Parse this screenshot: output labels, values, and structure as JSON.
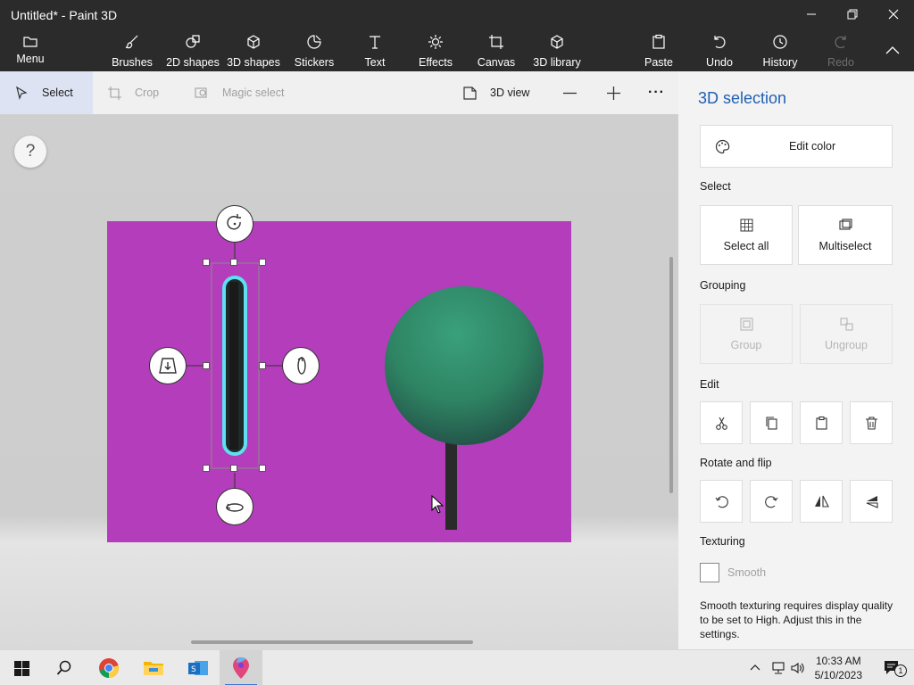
{
  "window": {
    "title": "Untitled* - Paint 3D"
  },
  "ribbon": {
    "menu": "Menu",
    "brushes": "Brushes",
    "shapes2d": "2D shapes",
    "shapes3d": "3D shapes",
    "stickers": "Stickers",
    "text": "Text",
    "effects": "Effects",
    "canvas": "Canvas",
    "library3d": "3D library",
    "paste": "Paste",
    "undo": "Undo",
    "history": "History",
    "redo": "Redo"
  },
  "subbar": {
    "select": "Select",
    "crop": "Crop",
    "magic_select": "Magic select",
    "view3d": "3D view",
    "more": "···"
  },
  "workspace": {
    "help": "?"
  },
  "panel": {
    "title": "3D selection",
    "edit_color": "Edit color",
    "select_label": "Select",
    "select_all": "Select all",
    "multiselect": "Multiselect",
    "grouping_label": "Grouping",
    "group": "Group",
    "ungroup": "Ungroup",
    "edit_label": "Edit",
    "rotate_label": "Rotate and flip",
    "texturing_label": "Texturing",
    "smooth": "Smooth",
    "smooth_note": "Smooth texturing requires display quality to be set to High. Adjust this in the settings."
  },
  "taskbar": {
    "time": "10:33 AM",
    "date": "5/10/2023",
    "notifications": "1"
  },
  "colors": {
    "canvas": "#b43dbb",
    "sphere": "#2e8b6a",
    "accent": "#1f5fb5",
    "selection_glow": "#5de0f0"
  }
}
